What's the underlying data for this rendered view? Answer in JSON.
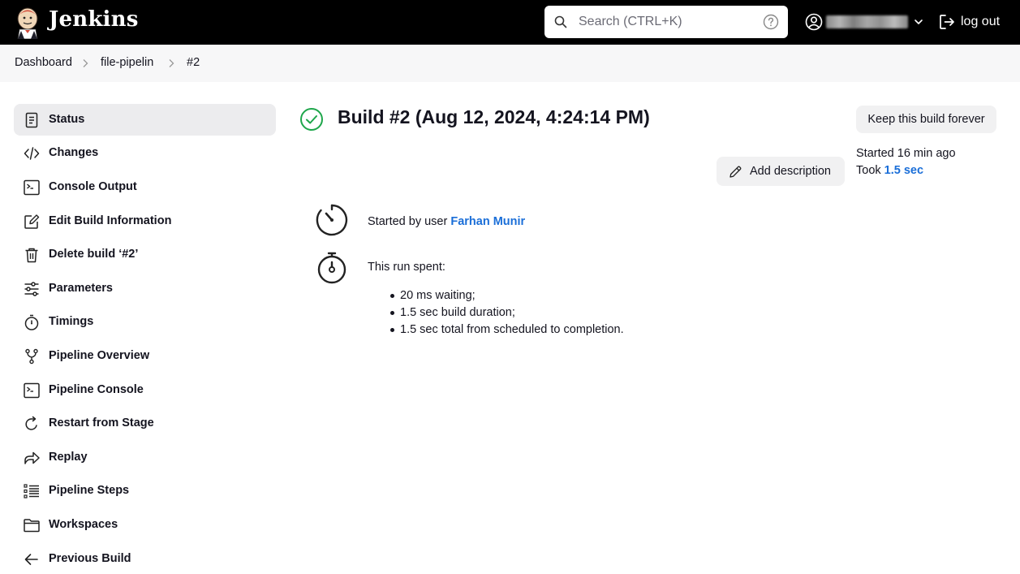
{
  "header": {
    "brand": "Jenkins",
    "search_placeholder": "Search (CTRL+K)",
    "logout_label": "log out"
  },
  "breadcrumb": {
    "items": [
      "Dashboard",
      "file-pipelin",
      "#2"
    ]
  },
  "sidebar": {
    "items": [
      {
        "label": "Status",
        "icon": "document-icon",
        "active": true
      },
      {
        "label": "Changes",
        "icon": "code-icon"
      },
      {
        "label": "Console Output",
        "icon": "terminal-icon"
      },
      {
        "label": "Edit Build Information",
        "icon": "edit-icon"
      },
      {
        "label": "Delete build ‘#2’",
        "icon": "trash-icon"
      },
      {
        "label": "Parameters",
        "icon": "sliders-icon"
      },
      {
        "label": "Timings",
        "icon": "stopwatch-icon"
      },
      {
        "label": "Pipeline Overview",
        "icon": "branch-icon"
      },
      {
        "label": "Pipeline Console",
        "icon": "terminal-icon"
      },
      {
        "label": "Restart from Stage",
        "icon": "restart-icon"
      },
      {
        "label": "Replay",
        "icon": "replay-icon"
      },
      {
        "label": "Pipeline Steps",
        "icon": "list-icon"
      },
      {
        "label": "Workspaces",
        "icon": "folder-icon"
      },
      {
        "label": "Previous Build",
        "icon": "arrow-left-icon"
      }
    ]
  },
  "main": {
    "title": "Build #2 (Aug 12, 2024, 4:24:14 PM)",
    "keep_label": "Keep this build forever",
    "add_description_label": "Add description",
    "started_ago": "Started 16 min ago",
    "took_prefix": "Took ",
    "took_value": "1.5 sec",
    "started_by_prefix": "Started by user ",
    "started_by_user": "Farhan Munir",
    "run_spent_label": "This run spent:",
    "run_spent_items": [
      "20 ms waiting;",
      "1.5 sec build duration;",
      "1.5 sec total from scheduled to completion."
    ]
  },
  "colors": {
    "header_bg": "#000000",
    "link": "#1a6ed8",
    "success": "#1ea64b",
    "active_bg": "#ececee"
  }
}
